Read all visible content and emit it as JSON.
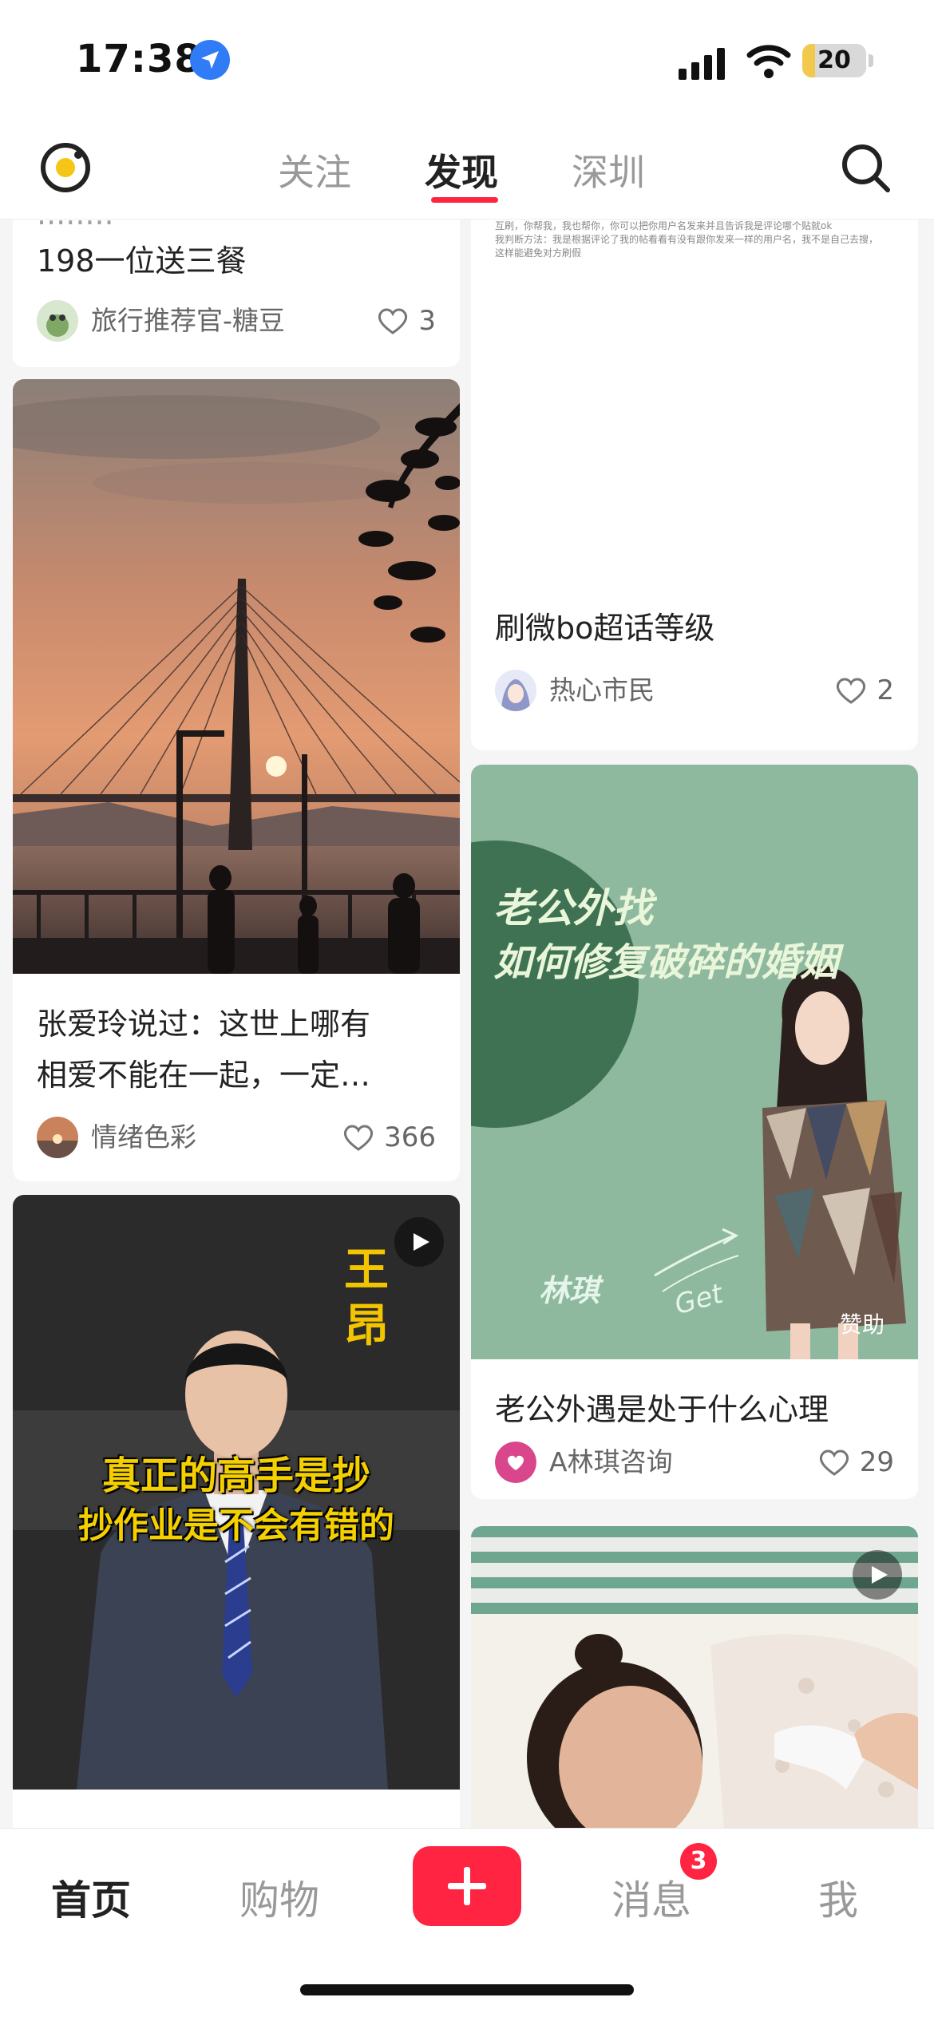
{
  "status_bar": {
    "time": "17:38",
    "battery": "20",
    "battery_level": 0.2
  },
  "top_nav": {
    "tabs": [
      {
        "label": "关注"
      },
      {
        "label": "发现"
      },
      {
        "label": "深圳"
      }
    ],
    "active_tab": "发现"
  },
  "feed": {
    "left": [
      {
        "title_line2": "198一位送三餐",
        "author": "旅行推荐官-糖豆",
        "likes": "3"
      },
      {
        "title_line1": "张爱玲说过：这世上哪有",
        "title_line2": "相爱不能在一起，一定…",
        "author": "情绪色彩",
        "likes": "366",
        "image": {
          "type": "sunset-bridge-photo"
        }
      },
      {
        "is_video": true,
        "image": {
          "type": "man-in-suit-photo",
          "name_overlay": "王昂",
          "caption_line1": "真正的高手是抄",
          "caption_line2": "抄作业是不会有错的"
        }
      }
    ],
    "right": [
      {
        "tiny_text_line1": "互刷，你帮我，我也帮你，你可以把你用户名发来并且告诉我是评论哪个贴就ok",
        "tiny_text_line2": "我判断方法：我是根据评论了我的帖看看有没有跟你发来一样的用户名，我不是自己去搜，",
        "tiny_text_line3": "这样能避免对方刷假",
        "title": "刷微bo超话等级",
        "author": "热心市民",
        "likes": "2"
      },
      {
        "title": "老公外遇是处于什么心理",
        "author": "A林琪咨询",
        "likes": "29",
        "image": {
          "headline_line1": "老公外找",
          "headline_line2": "如何修复破碎的婚姻",
          "name": "林琪",
          "get": "Get",
          "sponsor": "赞助"
        }
      },
      {
        "is_video": true,
        "image": {
          "type": "hospital-photo"
        }
      }
    ]
  },
  "bottom_bar": {
    "tabs": [
      {
        "label": "首页"
      },
      {
        "label": "购物"
      },
      {
        "label": "消息"
      },
      {
        "label": "我"
      }
    ],
    "active_tab": "首页",
    "messages_badge": "3"
  },
  "colors": {
    "accent": "#ff2442",
    "card_bg": "#ffffff",
    "feed_bg": "#f5f5f5",
    "ad_green": "#8fb99f"
  }
}
